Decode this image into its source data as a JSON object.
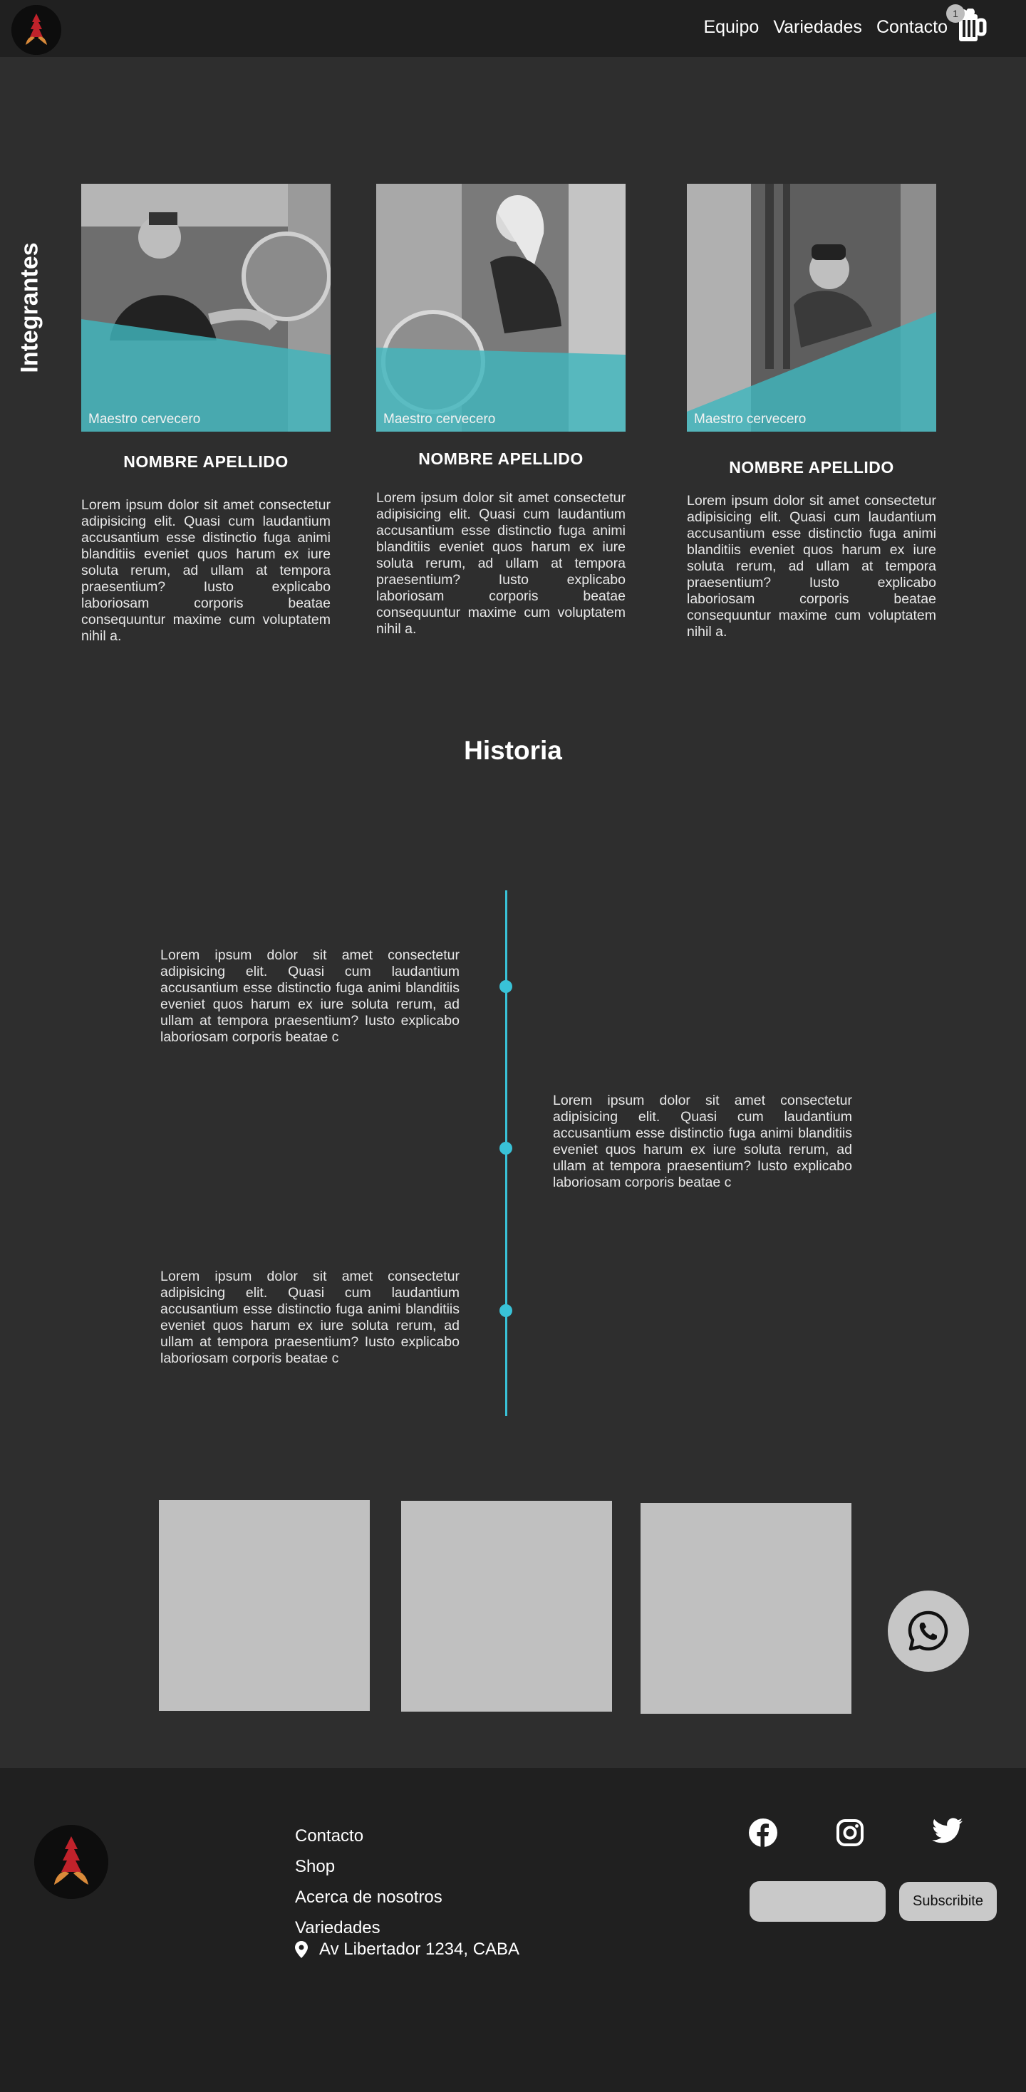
{
  "header": {
    "nav": [
      "Equipo",
      "Variedades",
      "Contacto"
    ],
    "cart_count": "1"
  },
  "team": {
    "section_title": "Integrantes",
    "members": [
      {
        "role": "Maestro cervecero",
        "name": "NOMBRE APELLIDO",
        "bio": "Lorem ipsum dolor sit amet consectetur adipisicing elit. Quasi cum laudantium accusantium esse distinctio fuga animi blanditiis eveniet quos harum ex iure soluta rerum, ad ullam at tempora praesentium? Iusto explicabo laboriosam corporis beatae consequuntur maxime cum voluptatem nihil a."
      },
      {
        "role": "Maestro cervecero",
        "name": "NOMBRE APELLIDO",
        "bio": "Lorem ipsum dolor sit amet consectetur adipisicing elit. Quasi cum laudantium accusantium esse distinctio fuga animi blanditiis eveniet quos harum ex iure soluta rerum, ad ullam at tempora praesentium? Iusto explicabo laboriosam corporis beatae consequuntur maxime cum voluptatem nihil a."
      },
      {
        "role": "Maestro cervecero",
        "name": "NOMBRE APELLIDO",
        "bio": "Lorem ipsum dolor sit amet consectetur adipisicing elit. Quasi cum laudantium accusantium esse distinctio fuga animi blanditiis eveniet quos harum ex iure soluta rerum, ad ullam at tempora praesentium? Iusto explicabo laboriosam corporis beatae consequuntur maxime cum voluptatem nihil a."
      }
    ]
  },
  "history": {
    "title": "Historia",
    "entries": [
      "Lorem ipsum dolor sit amet consectetur adipisicing elit. Quasi cum laudantium accusantium esse distinctio fuga animi blanditiis eveniet quos harum ex iure soluta rerum, ad ullam at tempora praesentium? Iusto explicabo laboriosam corporis beatae c",
      "Lorem ipsum dolor sit amet consectetur adipisicing elit. Quasi cum laudantium accusantium esse distinctio fuga animi blanditiis eveniet quos harum ex iure soluta rerum, ad ullam at tempora praesentium? Iusto explicabo laboriosam corporis beatae c",
      "Lorem ipsum dolor sit amet consectetur adipisicing elit. Quasi cum laudantium accusantium esse distinctio fuga animi blanditiis eveniet quos harum ex iure soluta rerum, ad ullam at tempora praesentium? Iusto explicabo laboriosam corporis beatae c"
    ]
  },
  "footer": {
    "links": [
      "Contacto",
      "Shop",
      "Acerca de nosotros",
      "Variedades"
    ],
    "address": "Av Libertador 1234, CABA",
    "subscribe_label": "Subscribite"
  },
  "icons": {
    "cart": "beer-mug-icon",
    "whatsapp": "whatsapp-icon",
    "location": "location-pin-icon",
    "social": [
      "facebook-icon",
      "instagram-icon",
      "twitter-icon"
    ]
  },
  "colors": {
    "accent": "#39c2d7",
    "photo_overlay": "#3fb6bd",
    "background": "#2e2e2e",
    "header_footer": "#202020",
    "placeholder": "#c0c0c0"
  }
}
